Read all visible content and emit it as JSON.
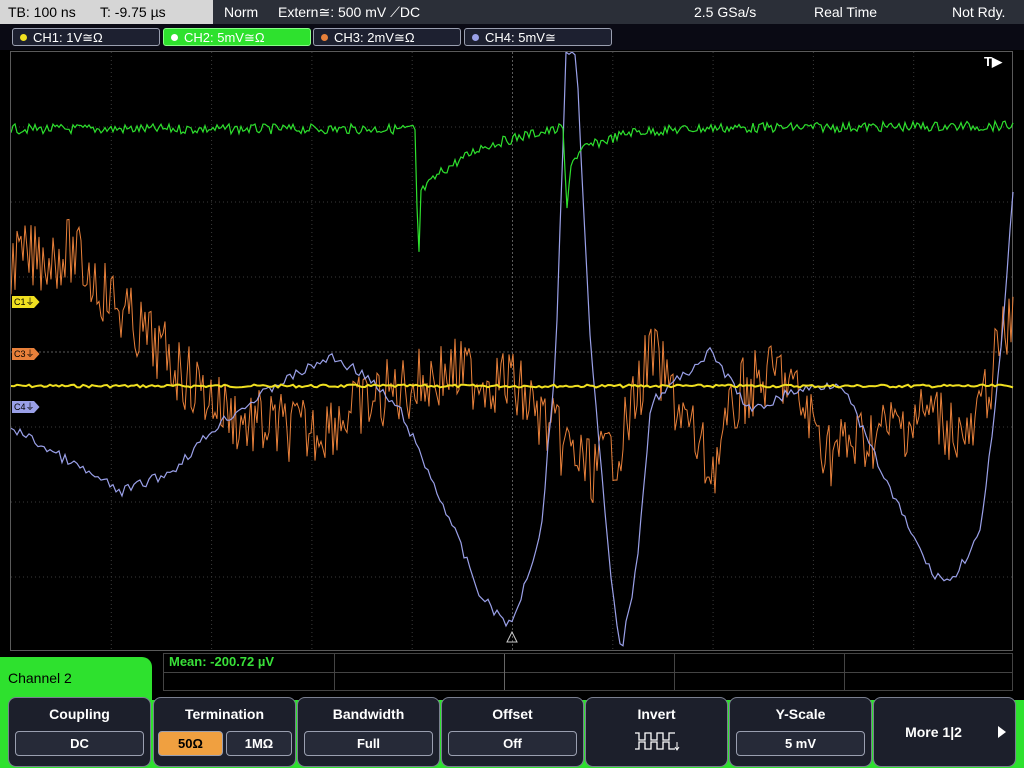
{
  "status_bar": {
    "timebase": "TB: 100 ns",
    "trigger_time": "T: -9.75 µs",
    "trigger_mode": "Norm",
    "trigger_source": "Extern≅: 500 mV ⟋DC",
    "sample_rate": "2.5 GSa/s",
    "acq_mode": "Real Time",
    "run_state": "Not Rdy."
  },
  "channels": [
    {
      "label": "CH1: 1V≅Ω",
      "color": "#f0e020"
    },
    {
      "label": "CH2: 5mV≅Ω",
      "color": "#2ee12e"
    },
    {
      "label": "CH3: 2mV≅Ω",
      "color": "#e8803a"
    },
    {
      "label": "CH4: 5mV≅",
      "color": "#9aa0e8"
    }
  ],
  "markers": {
    "c1": "C1",
    "c3": "C3",
    "c4": "C4"
  },
  "trigger_marker": "T▶",
  "measurement": {
    "mean": "Mean: -200.72 µV"
  },
  "channel_panel": {
    "title": "Channel 2"
  },
  "softkeys": {
    "coupling": {
      "title": "Coupling",
      "value": "DC"
    },
    "termination": {
      "title": "Termination",
      "opt1": "50Ω",
      "opt2": "1MΩ"
    },
    "bandwidth": {
      "title": "Bandwidth",
      "value": "Full"
    },
    "offset": {
      "title": "Offset",
      "value": "Off"
    },
    "invert": {
      "title": "Invert"
    },
    "yscale": {
      "title": "Y-Scale",
      "value": "5 mV"
    },
    "more": {
      "label": "More 1|2"
    }
  }
}
